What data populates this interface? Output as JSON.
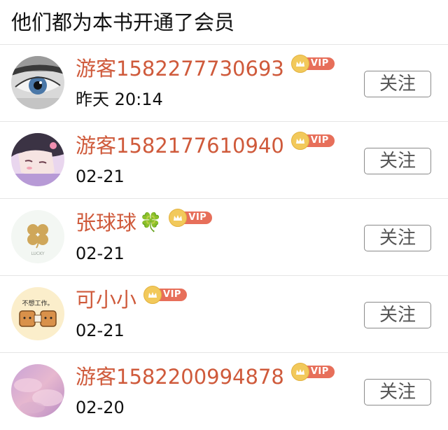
{
  "header": {
    "title": "他们都为本书开通了会员"
  },
  "members": [
    {
      "name": "游客1582277730693",
      "clover": "",
      "vip": "VIP",
      "time": "昨天 20:14",
      "follow": "关注",
      "avatar": "eye-avatar"
    },
    {
      "name": "游客1582177610940",
      "clover": "",
      "vip": "VIP",
      "time": "02-21",
      "follow": "关注",
      "avatar": "anime-girl-avatar"
    },
    {
      "name": "张球球",
      "clover": "🍀",
      "vip": "VIP",
      "time": "02-21",
      "follow": "关注",
      "avatar": "lucky-clover-avatar"
    },
    {
      "name": "可小小",
      "clover": "",
      "vip": "VIP",
      "time": "02-21",
      "follow": "关注",
      "avatar": "toast-avatar"
    },
    {
      "name": "游客1582200994878",
      "clover": "",
      "vip": "VIP",
      "time": "02-20",
      "follow": "关注",
      "avatar": "pink-sky-avatar"
    }
  ],
  "avatar_texts": {
    "toast_caption": "不想工作。",
    "lucky_caption": "LUCKY"
  },
  "colors": {
    "name": "#cf5a3b",
    "vip_badge": "#e76f5a",
    "crown": "#f2c95b",
    "divider": "#e5e5e5"
  }
}
